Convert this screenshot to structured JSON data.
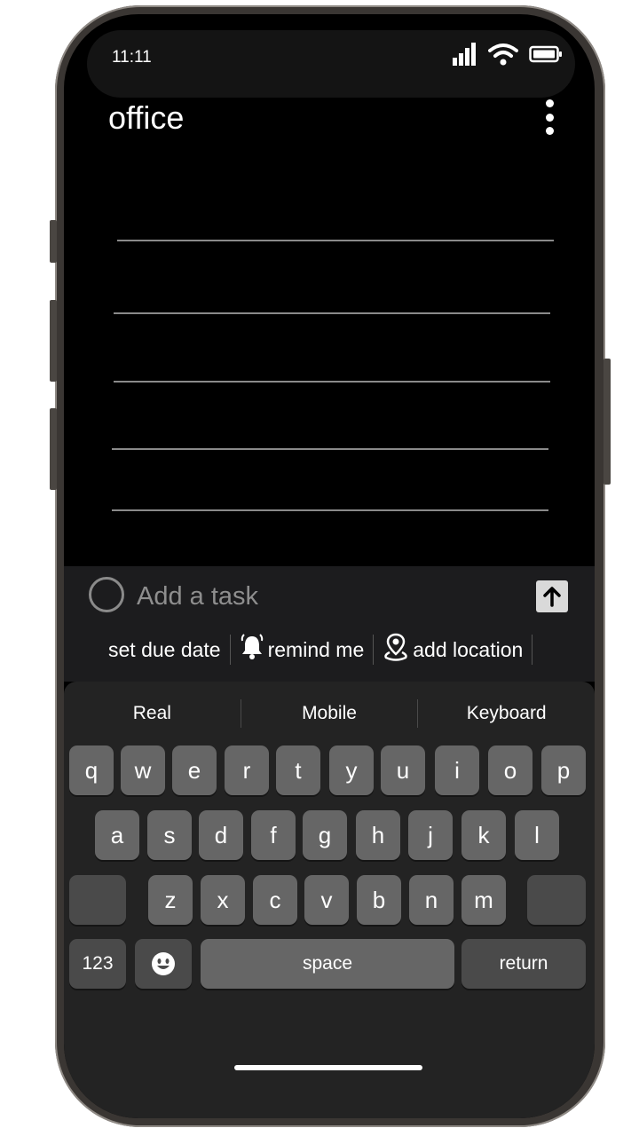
{
  "status_bar": {
    "time": "11:11",
    "icons": [
      "cellular-signal-icon",
      "wifi-icon",
      "battery-icon"
    ]
  },
  "header": {
    "title": "office",
    "menu_icon": "more-vertical-icon"
  },
  "composer": {
    "placeholder": "Add a task",
    "value": "",
    "send_icon": "arrow-up-icon",
    "chips": [
      {
        "label": "set due date",
        "icon": ""
      },
      {
        "label": "remind me",
        "icon": "bell-icon"
      },
      {
        "label": "add location",
        "icon": "map-pin-icon"
      }
    ]
  },
  "keyboard": {
    "suggestions": [
      "Real",
      "Mobile",
      "Keyboard"
    ],
    "row1": [
      "q",
      "w",
      "e",
      "r",
      "t",
      "y",
      "u",
      "i",
      "o",
      "p"
    ],
    "row2": [
      "a",
      "s",
      "d",
      "f",
      "g",
      "h",
      "j",
      "k",
      "l"
    ],
    "row3": [
      "z",
      "x",
      "c",
      "v",
      "b",
      "n",
      "m"
    ],
    "numbers_label": "123",
    "emoji_icon": "emoji-icon",
    "space_label": "space",
    "return_label": "return",
    "shift_icon": "shift-icon",
    "delete_icon": "delete-icon"
  },
  "colors": {
    "background": "#000000",
    "keyboard": "#232323",
    "key": "#666666",
    "key_dark": "#4a4a4a",
    "accent": "#ffffff"
  }
}
